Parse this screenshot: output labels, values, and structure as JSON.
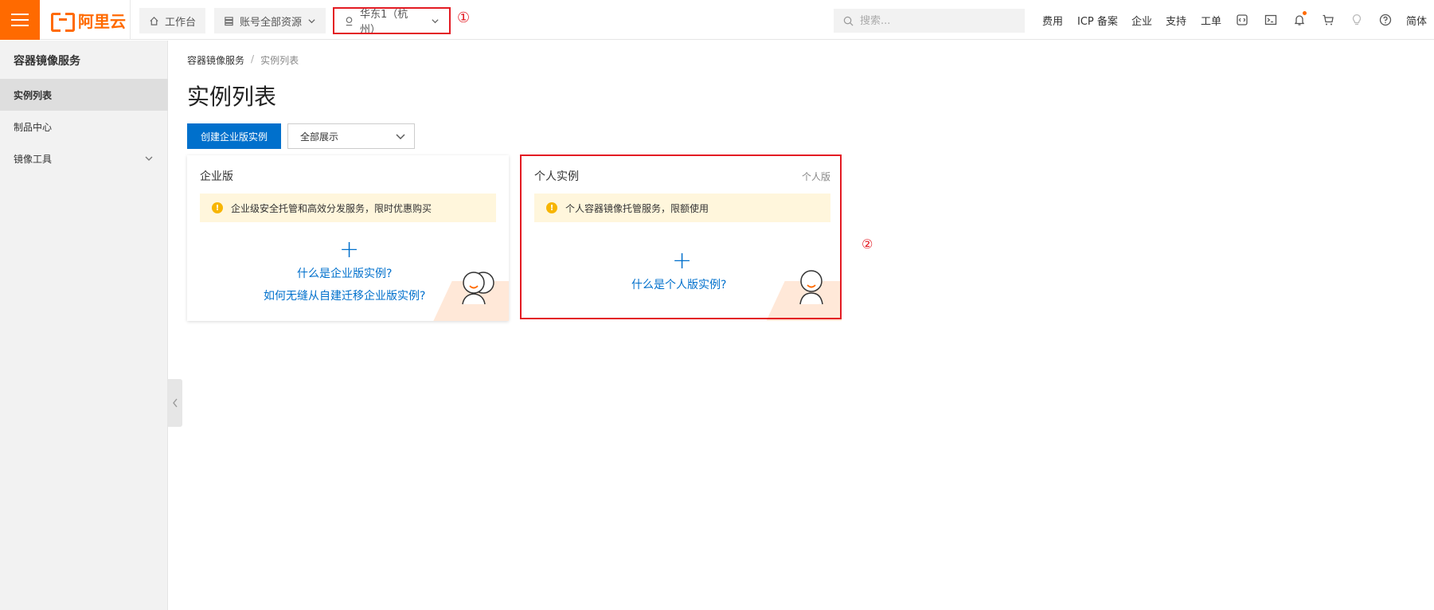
{
  "brand": {
    "logo_text": "阿里云",
    "accent": "#ff6a00",
    "primary": "#0070cc",
    "annotation_color": "#e31b23"
  },
  "topbar": {
    "workbench": "工作台",
    "resources": "账号全部资源",
    "region": "华东1（杭州）",
    "region_marker": "①",
    "search_placeholder": "搜索...",
    "links": {
      "fees": "费用",
      "icp": "ICP 备案",
      "enterprise": "企业",
      "support": "支持",
      "ticket": "工单",
      "language": "简体"
    }
  },
  "sidebar": {
    "title": "容器镜像服务",
    "items": [
      {
        "label": "实例列表",
        "active": true
      },
      {
        "label": "制品中心",
        "active": false
      },
      {
        "label": "镜像工具",
        "active": false,
        "expandable": true
      }
    ]
  },
  "breadcrumb": {
    "parent": "容器镜像服务",
    "separator": "/",
    "current": "实例列表"
  },
  "page": {
    "title": "实例列表",
    "create_button": "创建企业版实例",
    "filter_select": "全部展示"
  },
  "cards": {
    "enterprise": {
      "title": "企业版",
      "notice": "企业级安全托管和高效分发服务，限时优惠购买",
      "link_1": "什么是企业版实例?",
      "link_2": "如何无缝从自建迁移企业版实例?"
    },
    "personal": {
      "title": "个人实例",
      "tag": "个人版",
      "notice": "个人容器镜像托管服务，限额使用",
      "link_1": "什么是个人版实例?",
      "marker": "②"
    }
  }
}
